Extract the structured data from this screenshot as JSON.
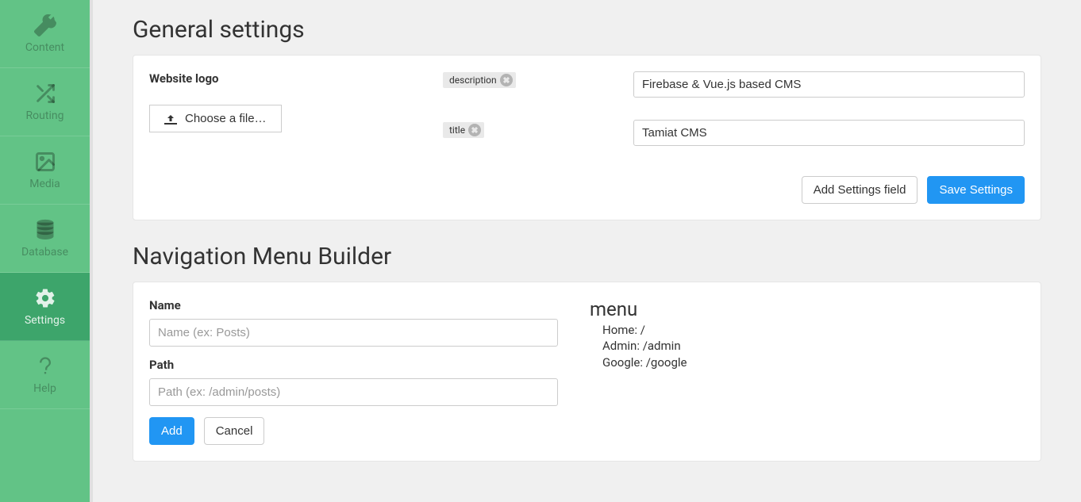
{
  "sidebar": {
    "items": [
      {
        "label": "Content"
      },
      {
        "label": "Routing"
      },
      {
        "label": "Media"
      },
      {
        "label": "Database"
      },
      {
        "label": "Settings"
      },
      {
        "label": "Help"
      }
    ]
  },
  "general": {
    "heading": "General settings",
    "logo_label": "Website logo",
    "file_button": "Choose a file…",
    "tags": {
      "description": "description",
      "title": "title"
    },
    "fields": {
      "description_value": "Firebase & Vue.js based CMS",
      "title_value": "Tamiat CMS"
    },
    "add_field_button": "Add Settings field",
    "save_button": "Save Settings"
  },
  "nav": {
    "heading": "Navigation Menu Builder",
    "name_label": "Name",
    "name_placeholder": "Name (ex: Posts)",
    "path_label": "Path",
    "path_placeholder": "Path (ex: /admin/posts)",
    "add_button": "Add",
    "cancel_button": "Cancel",
    "menu_title": "menu",
    "menu_items": [
      {
        "name": "Home",
        "path": "/"
      },
      {
        "name": "Admin",
        "path": "/admin"
      },
      {
        "name": "Google",
        "path": "/google"
      }
    ]
  }
}
